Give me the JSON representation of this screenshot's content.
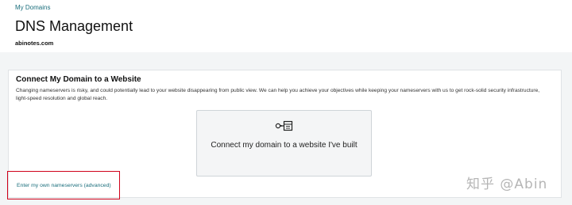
{
  "header": {
    "breadcrumb": "My Domains",
    "title": "DNS Management",
    "domain": "abinotes.com"
  },
  "card": {
    "title": "Connect My Domain to a Website",
    "description": "Changing nameservers is risky, and could potentially lead to your website disappearing from public view. We can help you achieve your objectives while keeping your nameservers with us to get rock-solid security infrastructure, light-speed resolution and global reach.",
    "option": {
      "icon": "domain-connect-icon",
      "label": "Connect my domain to a website I've built"
    },
    "advanced_link": "Enter my own nameservers (advanced)"
  },
  "annotation": {
    "highlight_color": "#d0021b"
  },
  "watermark": "知乎 @Abin",
  "colors": {
    "link": "#1a6e7c",
    "background": "#f3f5f6"
  }
}
